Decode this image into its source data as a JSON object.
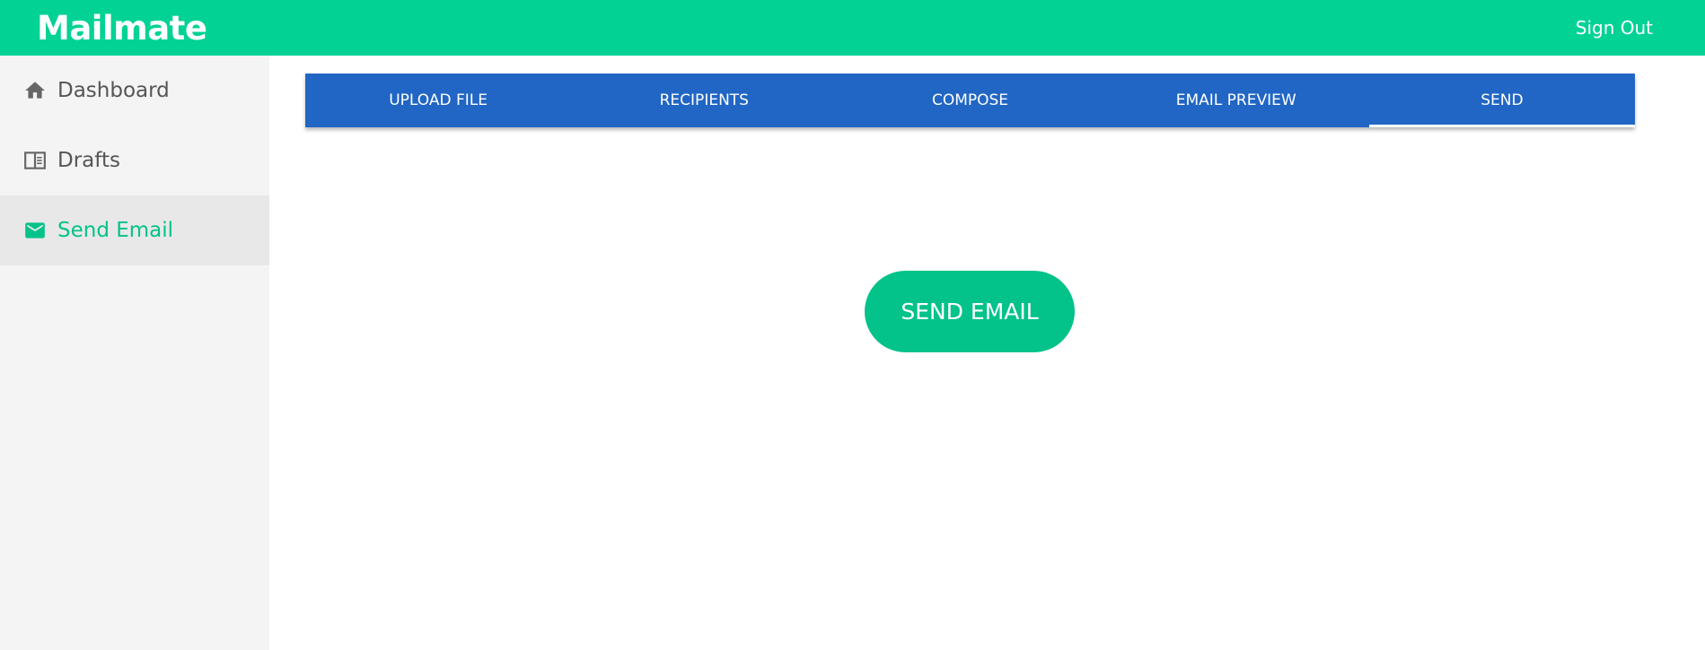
{
  "header": {
    "app_title": "Mailmate",
    "sign_out_label": "Sign Out",
    "brand_color": "#03d295"
  },
  "sidebar": {
    "items": [
      {
        "label": "Dashboard",
        "icon": "home-icon",
        "active": false
      },
      {
        "label": "Drafts",
        "icon": "drafts-icon",
        "active": false
      },
      {
        "label": "Send Email",
        "icon": "mail-icon",
        "active": true
      }
    ],
    "active_color": "#03c28a"
  },
  "tabs": {
    "items": [
      {
        "label": "UPLOAD FILE",
        "active": false
      },
      {
        "label": "RECIPIENTS",
        "active": false
      },
      {
        "label": "COMPOSE",
        "active": false
      },
      {
        "label": "EMAIL PREVIEW",
        "active": false
      },
      {
        "label": "SEND",
        "active": true
      }
    ],
    "bar_color": "#2166c4"
  },
  "main": {
    "send_button_label": "SEND EMAIL"
  }
}
